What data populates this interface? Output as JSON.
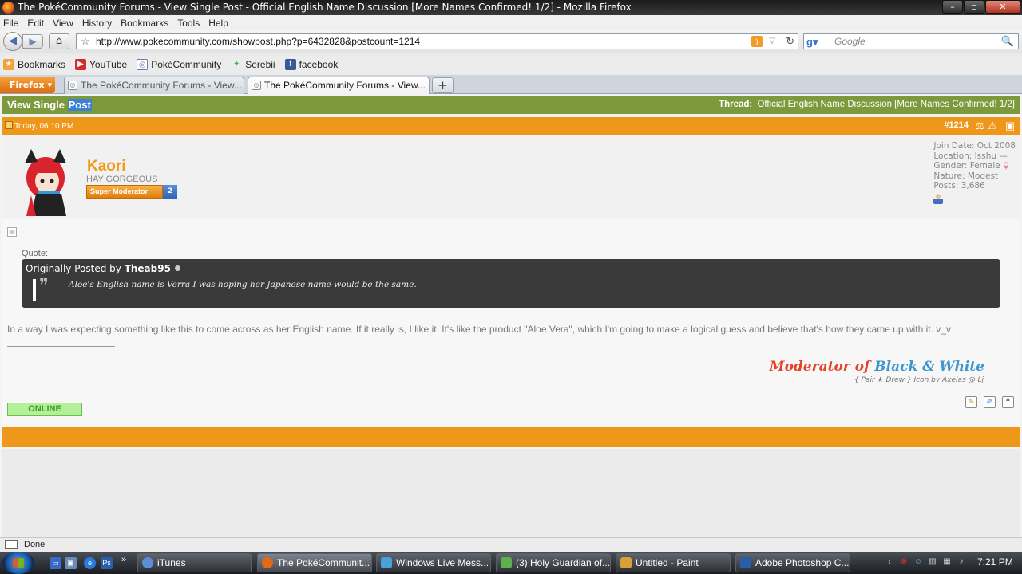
{
  "window": {
    "title": "The PokéCommunity Forums - View Single Post - Official English Name Discussion [More Names Confirmed! 1/2] - Mozilla Firefox",
    "min": "–",
    "max": "▫",
    "close": "✕"
  },
  "menu": [
    "File",
    "Edit",
    "View",
    "History",
    "Bookmarks",
    "Tools",
    "Help"
  ],
  "nav": {
    "url": "http://www.pokecommunity.com/showpost.php?p=6432828&postcount=1214",
    "search_placeholder": "Google",
    "back": "◀",
    "forward": "▶",
    "home": "⌂",
    "star": "☆",
    "reload": "↻",
    "magnifier": "🔍"
  },
  "bookmarks": [
    {
      "label": "Bookmarks",
      "icon": "star-icon",
      "color": "#f3a23a"
    },
    {
      "label": "YouTube",
      "icon": "youtube-icon",
      "color": "#d12b2b"
    },
    {
      "label": "PokéCommunity",
      "icon": "pokecommunity-icon",
      "color": "#6c7fa4"
    },
    {
      "label": "Serebii",
      "icon": "serebii-icon",
      "color": "#4fa84f"
    },
    {
      "label": "facebook",
      "icon": "facebook-icon",
      "color": "#3b5998"
    }
  ],
  "tabs": {
    "firefox_button": "Firefox",
    "items": [
      {
        "label": "The PokéCommunity Forums - View..."
      },
      {
        "label": "The PokéCommunity Forums - View..."
      }
    ],
    "new_tab": "+"
  },
  "page": {
    "header_title_prefix": "View Single ",
    "header_title_highlight": "Post",
    "thread_label": "Thread:",
    "thread_title": "Official English Name Discussion [More Names Confirmed! 1/2]",
    "post_date": "Today, 06:10 PM",
    "post_number": "#1214",
    "colors": {
      "green": "#7c9a3c",
      "orange": "#ee9718"
    }
  },
  "user": {
    "name": "Kaori",
    "title": "HAY GORGEOUS",
    "rank": "Super Moderator",
    "rank_level": "2",
    "join_date": "Join Date: Oct 2008",
    "location": "Location: Isshu —",
    "gender": "Gender: Female",
    "gender_symbol": "♀",
    "nature": "Nature: Modest",
    "posts": "Posts: 3,686"
  },
  "post": {
    "quote_label": "Quote:",
    "quote_prefix": "Originally Posted by",
    "quote_author": "Theab95",
    "quote_text": "Aloe's English name is Verra I was hoping her Japanese name would be the same.",
    "body": "In a way I was expecting something like this to come across as her English name. If it really is, I like it. It's like the product \"Aloe Vera\", which I'm going to make a logical guess and believe that's how they came up with it. v_v",
    "sig_prefix": "Moderator of",
    "sig_highlight": "Black & White",
    "sig_sub": "{ Pair ★ Drew } Icon by Axelas @ Lj",
    "online": "ONLINE"
  },
  "status": {
    "text": "Done"
  },
  "taskbar": {
    "quick_more": "»",
    "tasks": [
      {
        "label": "iTunes",
        "color": "#5a8ed6"
      },
      {
        "label": "The PokéCommunit...",
        "color": "#e06a1a"
      },
      {
        "label": "Windows Live Mess...",
        "color": "#4aa0d8"
      },
      {
        "label": "(3) Holy Guardian of...",
        "color": "#5fb04a"
      },
      {
        "label": "Untitled - Paint",
        "color": "#d8a03a"
      },
      {
        "label": "Adobe Photoshop C...",
        "color": "#2a5fa8"
      }
    ],
    "clock": "7:21 PM"
  }
}
